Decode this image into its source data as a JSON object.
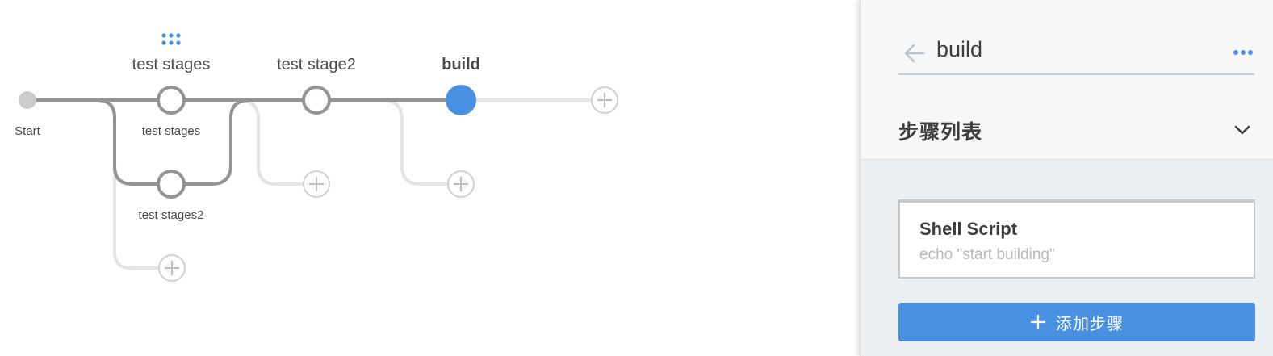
{
  "pipeline": {
    "start_label": "Start",
    "stages": [
      {
        "id": "parallel",
        "header": "test stages",
        "branches": [
          "test stages",
          "test stages2"
        ]
      },
      {
        "id": "stage2",
        "header": "test stage2"
      },
      {
        "id": "build",
        "header": "build",
        "selected": true
      }
    ]
  },
  "panel": {
    "stage_name": "build",
    "steps_heading": "步骤列表",
    "steps": [
      {
        "title": "Shell Script",
        "description": "echo \"start building\""
      }
    ],
    "add_step_label": "添加步骤"
  },
  "colors": {
    "accent": "#4a90e2",
    "line_active": "#949494",
    "line_inactive": "#e4e4e4",
    "start_node": "#cccccc"
  }
}
